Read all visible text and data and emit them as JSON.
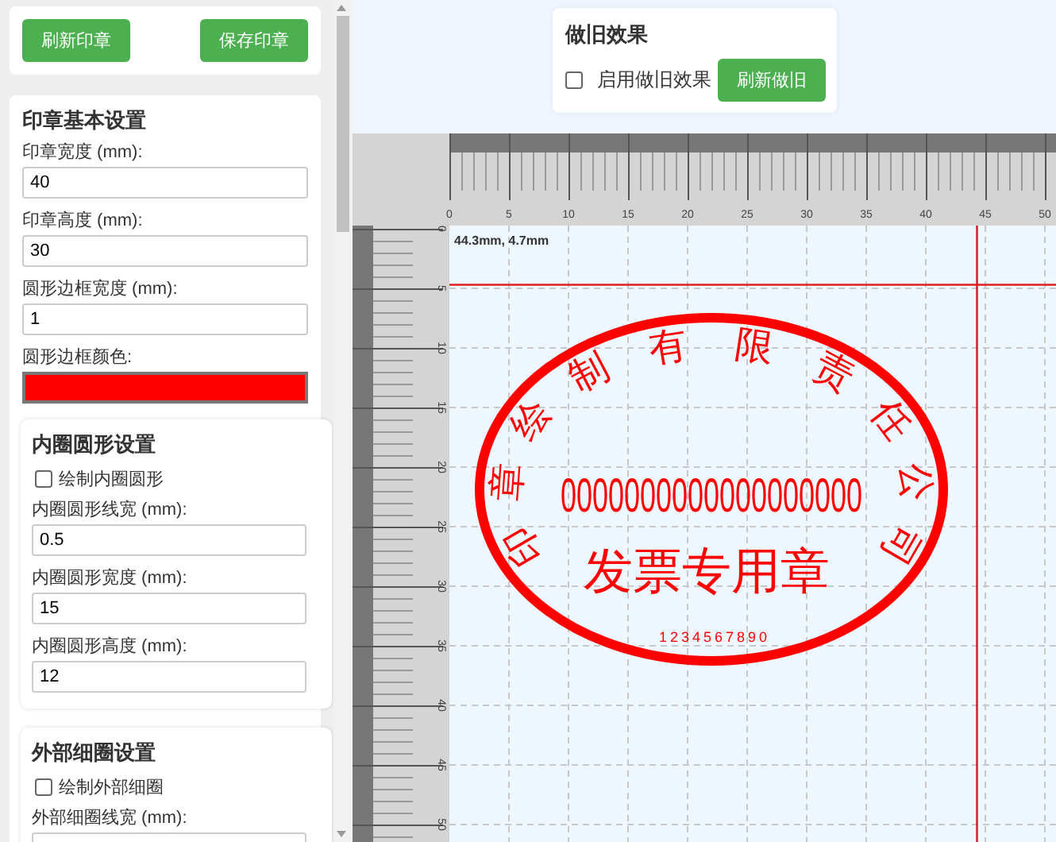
{
  "sidebar": {
    "buttons": [
      "刷新印章",
      "保存印章"
    ],
    "basic_settings": {
      "title": "印章基本设置",
      "fields": [
        {
          "kind": "number",
          "label": "印章宽度 (mm):",
          "value": "40"
        },
        {
          "kind": "number",
          "label": "印章高度 (mm):",
          "value": "30"
        },
        {
          "kind": "number",
          "label": "圆形边框宽度 (mm):",
          "value": "1"
        },
        {
          "kind": "color",
          "label": "圆形边框颜色:",
          "color": "#ff0000"
        }
      ],
      "subsections": [
        {
          "title": "内圈圆形设置",
          "checkbox": {
            "label": "绘制内圈圆形",
            "checked": false
          },
          "fields": [
            {
              "kind": "number",
              "label": "内圈圆形线宽 (mm):",
              "value": "0.5"
            },
            {
              "kind": "number",
              "label": "内圈圆形宽度 (mm):",
              "value": "15"
            },
            {
              "kind": "number",
              "label": "内圈圆形高度 (mm):",
              "value": "12"
            }
          ]
        },
        {
          "title": "外部细圈设置",
          "checkbox": {
            "label": "绘制外部细圈",
            "checked": false
          },
          "fields": [
            {
              "kind": "number",
              "label": "外部细圈线宽 (mm):"
            }
          ]
        }
      ]
    }
  },
  "aging_panel": {
    "title": "做旧效果",
    "checkbox": {
      "label": "启用做旧效果",
      "checked": false
    },
    "button": "刷新做旧"
  },
  "canvas": {
    "top_ruler_labels": [
      "0",
      "5",
      "10",
      "15",
      "20",
      "25",
      "30",
      "35",
      "40",
      "45",
      "50"
    ],
    "left_ruler_labels": [
      "0",
      "5",
      "10",
      "15",
      "20",
      "25",
      "30",
      "35",
      "40",
      "45",
      "50"
    ],
    "cursor_readout": "44.3mm, 4.7mm",
    "stamp": {
      "company_name_characters": [
        "印",
        "章",
        "绘",
        "制",
        "有",
        "限",
        "责",
        "任",
        "公",
        "司"
      ],
      "center_number": "0000000000000000000",
      "title": "发票专用章",
      "bottom_code": "1234567890"
    }
  }
}
